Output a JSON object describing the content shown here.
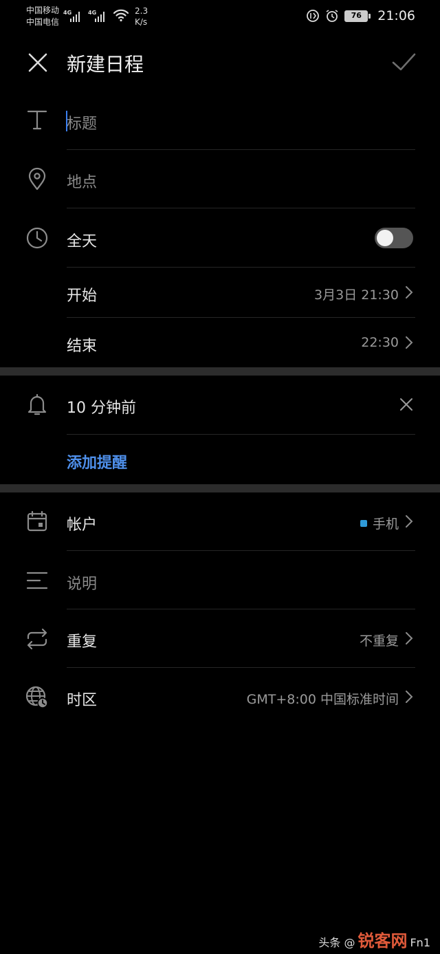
{
  "status_bar": {
    "carrier_1": "中国移动",
    "carrier_2": "中国电信",
    "network_1": "4G",
    "network_2": "4G",
    "speed_value": "2.3",
    "speed_unit": "K/s",
    "battery": "76",
    "time": "21:06"
  },
  "header": {
    "title": "新建日程"
  },
  "form": {
    "title_placeholder": "标题",
    "location_placeholder": "地点",
    "all_day_label": "全天",
    "all_day_on": false,
    "start_label": "开始",
    "start_value": "3月3日 21:30",
    "end_label": "结束",
    "end_value": "22:30"
  },
  "reminders": {
    "item_label": "10 分钟前",
    "add_label": "添加提醒"
  },
  "details": {
    "account_label": "帐户",
    "account_value": "手机",
    "account_color": "#2f9ad8",
    "description_placeholder": "说明",
    "repeat_label": "重复",
    "repeat_value": "不重复",
    "timezone_label": "时区",
    "timezone_value": "GMT+8:00 中国标准时间"
  },
  "watermark": {
    "prefix": "头条 @",
    "brand": "锐客网",
    "suffix": "Fn1"
  },
  "colors": {
    "accent": "#4e8fea",
    "background": "#000000",
    "separator": "#2c2c2c"
  }
}
